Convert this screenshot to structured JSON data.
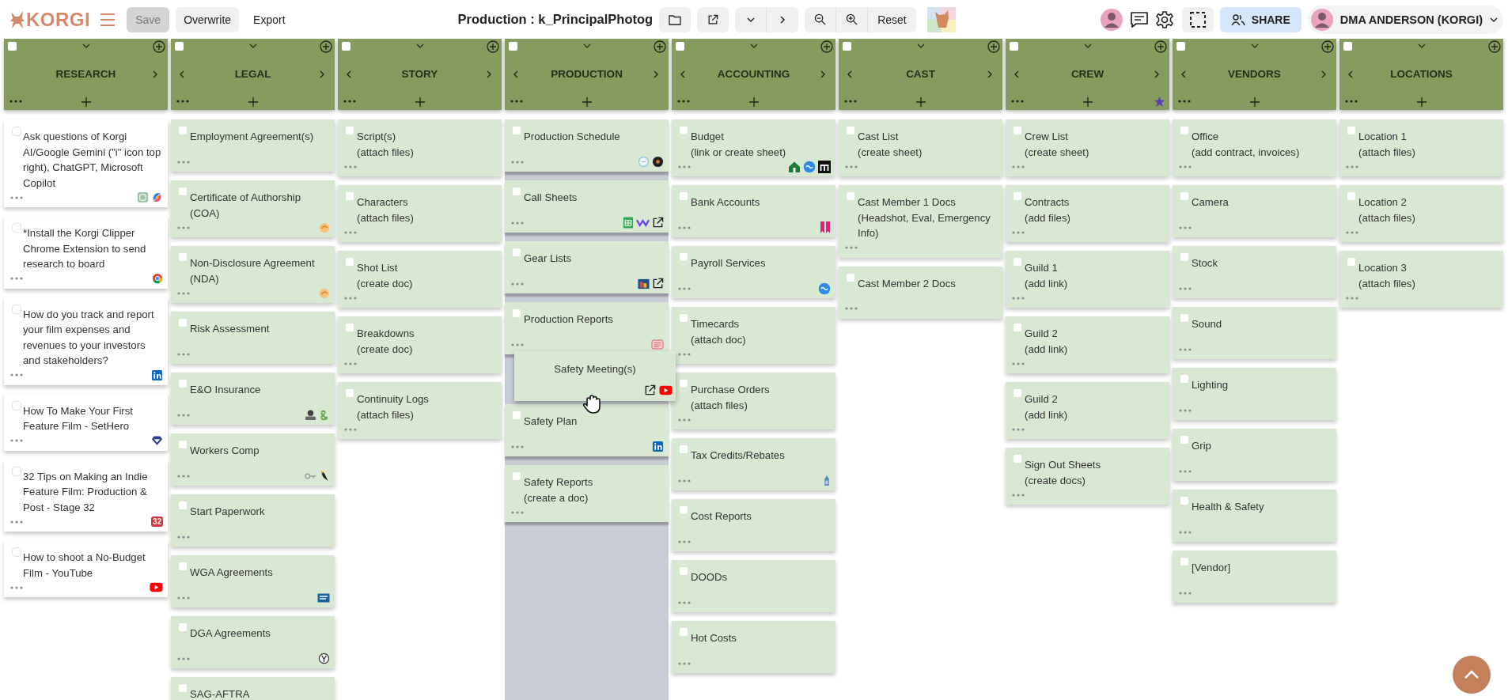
{
  "toolbar": {
    "logo": "KORGI",
    "buttons": [
      {
        "label": "Save",
        "kind": "filled",
        "disabled": true
      },
      {
        "label": "Overwrite",
        "kind": "filled",
        "disabled": false
      },
      {
        "label": "Export",
        "kind": "plain",
        "disabled": false
      }
    ],
    "title": "Production : k_PrincipalPhotog",
    "reset": "Reset",
    "share": "SHARE",
    "user": "DMA ANDERSON (KORGI)"
  },
  "columns": [
    {
      "title": "RESEARCH",
      "color": "#ffffff",
      "checked": false,
      "starred": false,
      "drop_target": false,
      "cards": [
        {
          "title": "Ask questions of Korgi AI/Google Gemini (\"i\" icon top right), ChatGPT, Microsoft Copilot",
          "checked": false
        },
        {
          "title": "*Install the Korgi Clipper Chrome Extension to send research to board",
          "checked": false
        },
        {
          "title": "How do you track and report your film expenses and revenues to your investors and stakeholders?",
          "checked": false
        },
        {
          "title": "How To Make Your First Feature Film - SetHero",
          "checked": false
        },
        {
          "title": "32 Tips on Making an Indie Feature Film: Production & Post - Stage 32",
          "checked": false,
          "badge": "32"
        },
        {
          "title": "How to shoot a No-Budget Film - YouTube",
          "checked": false
        }
      ]
    },
    {
      "title": "LEGAL",
      "color": "#d9e8d2",
      "checked": false,
      "starred": false,
      "drop_target": false,
      "cards": [
        {
          "title": "Employment Agreement(s)",
          "checked": false
        },
        {
          "title": "Certificate of Authorship\n(COA)",
          "checked": false
        },
        {
          "title": "Non-Disclosure Agreement\n(NDA)",
          "checked": false
        },
        {
          "title": "Risk Assessment",
          "checked": false
        },
        {
          "title": "E&O Insurance",
          "checked": false
        },
        {
          "title": "Workers Comp",
          "checked": false
        },
        {
          "title": "Start Paperwork",
          "checked": false
        },
        {
          "title": "WGA Agreements",
          "checked": false
        },
        {
          "title": "DGA Agreements",
          "checked": false
        },
        {
          "title": "SAG-AFTRA",
          "checked": false
        }
      ]
    },
    {
      "title": "STORY",
      "color": "#d9e8d2",
      "checked": false,
      "starred": false,
      "drop_target": false,
      "cards": [
        {
          "title": "Script(s)\n(attach files)",
          "checked": false
        },
        {
          "title": "Characters\n(attach files)",
          "checked": false
        },
        {
          "title": "Shot List\n(create doc)",
          "checked": false
        },
        {
          "title": "Breakdowns\n(create doc)",
          "checked": false
        },
        {
          "title": "Continuity Logs\n(attach files)",
          "checked": false
        }
      ]
    },
    {
      "title": "PRODUCTION",
      "color": "#d9e8d2",
      "checked": false,
      "starred": false,
      "drop_target": true,
      "cards": [
        {
          "title": "Production Schedule",
          "checked": false
        },
        {
          "title": "Call Sheets",
          "checked": false
        },
        {
          "title": "Gear Lists",
          "checked": false
        },
        {
          "title": "Production Reports",
          "checked": false
        },
        {
          "title": "Safety Plan",
          "checked": false
        },
        {
          "title": "Safety Reports\n(create a doc)",
          "checked": false
        }
      ]
    },
    {
      "title": "ACCOUNTING",
      "color": "#d9e8d2",
      "checked": false,
      "starred": false,
      "drop_target": false,
      "cards": [
        {
          "title": "Budget\n(link or create sheet)",
          "checked": false
        },
        {
          "title": "Bank Accounts",
          "checked": false
        },
        {
          "title": "Payroll Services",
          "checked": false
        },
        {
          "title": "Timecards\n(attach doc)",
          "checked": false
        },
        {
          "title": "Purchase Orders\n(attach files)",
          "checked": false
        },
        {
          "title": "Tax Credits/Rebates",
          "checked": false
        },
        {
          "title": "Cost Reports",
          "checked": false
        },
        {
          "title": "DOODs",
          "checked": false
        },
        {
          "title": "Hot Costs",
          "checked": false
        }
      ]
    },
    {
      "title": "CAST",
      "color": "#d9e8d2",
      "checked": false,
      "starred": false,
      "drop_target": false,
      "cards": [
        {
          "title": "Cast List\n(create sheet)",
          "checked": false
        },
        {
          "title": "Cast Member 1 Docs\n(Headshot, Eval, Emergency Info)",
          "checked": false
        },
        {
          "title": "Cast Member 2 Docs",
          "checked": false
        }
      ]
    },
    {
      "title": "CREW",
      "color": "#d9e8d2",
      "checked": false,
      "starred": true,
      "drop_target": false,
      "cards": [
        {
          "title": "Crew List\n(create sheet)",
          "checked": false
        },
        {
          "title": "Contracts\n(add files)",
          "checked": false
        },
        {
          "title": "Guild 1\n(add link)",
          "checked": false
        },
        {
          "title": "Guild 2\n(add link)",
          "checked": false
        },
        {
          "title": "Guild 2\n(add link)",
          "checked": false
        },
        {
          "title": "Sign Out Sheets\n(create docs)",
          "checked": false
        }
      ]
    },
    {
      "title": "VENDORS",
      "color": "#d9e8d2",
      "checked": false,
      "starred": false,
      "drop_target": false,
      "cards": [
        {
          "title": "Office\n(add contract, invoices)",
          "checked": false
        },
        {
          "title": "Camera",
          "checked": false
        },
        {
          "title": "Stock",
          "checked": false
        },
        {
          "title": "Sound",
          "checked": false
        },
        {
          "title": "Lighting",
          "checked": false
        },
        {
          "title": "Grip",
          "checked": false
        },
        {
          "title": "Health & Safety",
          "checked": false
        },
        {
          "title": "[Vendor]",
          "checked": false
        }
      ]
    },
    {
      "title": "LOCATIONS",
      "color": "#d9e8d2",
      "checked": false,
      "starred": false,
      "drop_target": false,
      "cards": [
        {
          "title": "Location 1\n(attach files)",
          "checked": false
        },
        {
          "title": "Location 2\n(attach files)",
          "checked": false
        },
        {
          "title": "Location 3\n(attach files)",
          "checked": false
        }
      ]
    }
  ],
  "dragging": {
    "title": "Safety Meeting(s)"
  }
}
